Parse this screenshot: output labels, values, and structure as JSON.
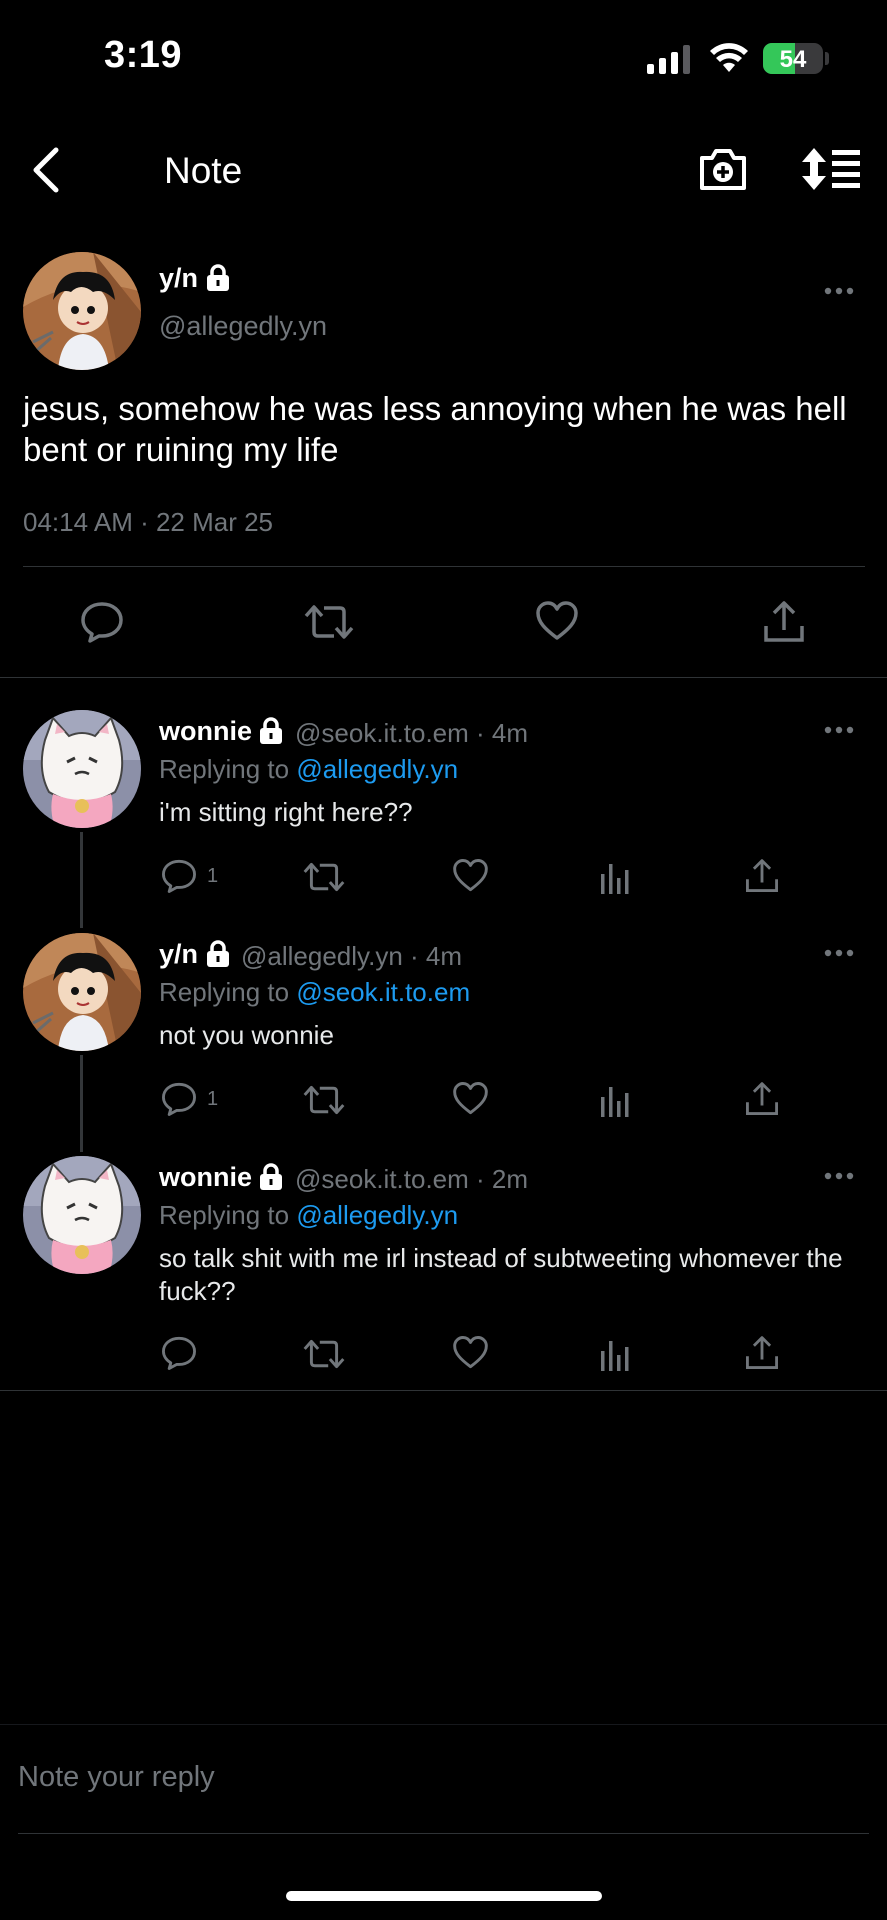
{
  "status_bar": {
    "time": "3:19",
    "battery": "54",
    "battery_level": 0.54
  },
  "header": {
    "title": "Note",
    "back_icon": "chevron-left-icon",
    "camera_icon": "camera-plus-icon",
    "sort_icon": "sort-list-icon"
  },
  "main_post": {
    "name": "y/n",
    "handle": "@allegedly.yn",
    "text": "jesus, somehow he was less annoying when he was hell bent or ruining my life",
    "timestamp": "04:14 AM · 22 Mar 25"
  },
  "replies": [
    {
      "name": "wonnie",
      "handle_time": "@seok.it.to.em · 4m",
      "replying_prefix": "Replying to ",
      "replying_to": "@allegedly.yn",
      "text": "i'm sitting right here??",
      "reply_count": "1"
    },
    {
      "name": "y/n",
      "handle_time": "@allegedly.yn · 4m",
      "replying_prefix": "Replying to ",
      "replying_to": "@seok.it.to.em",
      "text": "not you wonnie",
      "reply_count": "1"
    },
    {
      "name": "wonnie",
      "handle_time": "@seok.it.to.em · 2m",
      "replying_prefix": "Replying to ",
      "replying_to": "@allegedly.yn",
      "text": "so talk shit with me irl instead of subtweeting whomever the fuck??",
      "reply_count": ""
    }
  ],
  "compose": {
    "placeholder": "Note your reply"
  },
  "colors": {
    "accent": "#1d9bf0",
    "muted": "#71767b",
    "divider": "#2f3336",
    "background": "#000000"
  }
}
